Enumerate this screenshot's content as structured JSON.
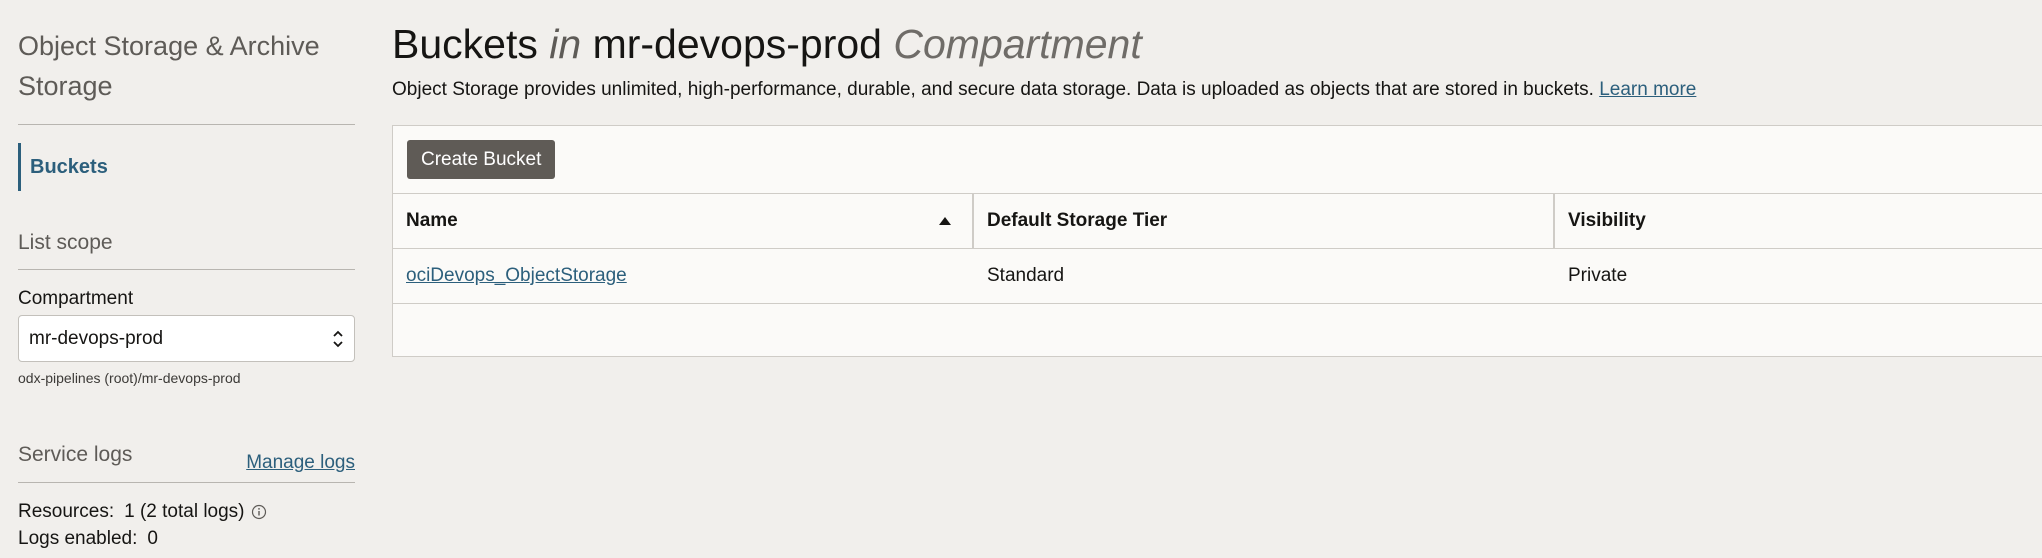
{
  "sidebar": {
    "title": "Object Storage & Archive Storage",
    "nav_items": [
      {
        "label": "Buckets",
        "active": true
      }
    ],
    "list_scope": {
      "heading": "List scope",
      "compartment_label": "Compartment",
      "compartment_value": "mr-devops-prod",
      "compartment_path": "odx-pipelines (root)/mr-devops-prod"
    },
    "service_logs": {
      "heading": "Service logs",
      "manage_link": "Manage logs",
      "resources_label": "Resources:",
      "resources_value": "1 (2 total logs)",
      "logs_enabled_label": "Logs enabled:",
      "logs_enabled_value": "0"
    }
  },
  "main": {
    "title_part1": "Buckets",
    "title_in": "in",
    "title_compartment_name": "mr-devops-prod",
    "title_part3": "Compartment",
    "description": "Object Storage provides unlimited, high-performance, durable, and secure data storage. Data is uploaded as objects that are stored in buckets.",
    "learn_more": "Learn more",
    "create_button": "Create Bucket",
    "table": {
      "columns": [
        "Name",
        "Default Storage Tier",
        "Visibility"
      ],
      "sort_column": "Name",
      "sort_direction": "ascending",
      "rows": [
        {
          "name": "ociDevops_ObjectStorage",
          "tier": "Standard",
          "visibility": "Private"
        }
      ]
    }
  },
  "colors": {
    "accent_link": "#2c5f7c",
    "button_bg": "#5f5b56",
    "page_bg": "#f1efec"
  },
  "icons": {
    "select_arrows": "chevron-up-down-icon",
    "info": "info-icon",
    "sort": "sort-ascending-icon"
  }
}
